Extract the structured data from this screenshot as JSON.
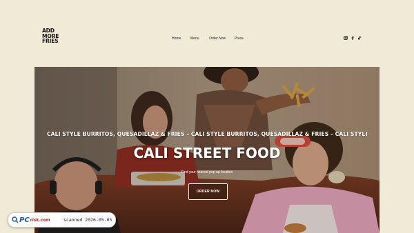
{
  "header": {
    "logo_lines": [
      "ADD",
      "MORE",
      "FRIES"
    ],
    "nav": [
      {
        "label": "Home"
      },
      {
        "label": "Menu"
      },
      {
        "label": "Order Now"
      },
      {
        "label": "Press"
      }
    ],
    "social_icons": [
      "instagram-icon",
      "facebook-icon",
      "tiktok-icon"
    ]
  },
  "hero": {
    "ticker": "CALI STYLE BURRITOS, QUESADILLAZ & FRIES – CALI STYLE BURRITOS, QUESADILLAZ & FRIES – CALI STYLE BURRITOS, QUESADILLAZ & FRIES – CALI",
    "title": "CALI STREET FOOD",
    "subtitle": "Find your nearest pop-up location",
    "cta_label": "ORDER NOW"
  },
  "watermark": {
    "brand_main": "PC",
    "brand_tail": "risk.com",
    "scan_text": "scanned 2026-05-05"
  },
  "colors": {
    "page_bg": "#f1ead7",
    "hero_text": "#ffffff"
  }
}
